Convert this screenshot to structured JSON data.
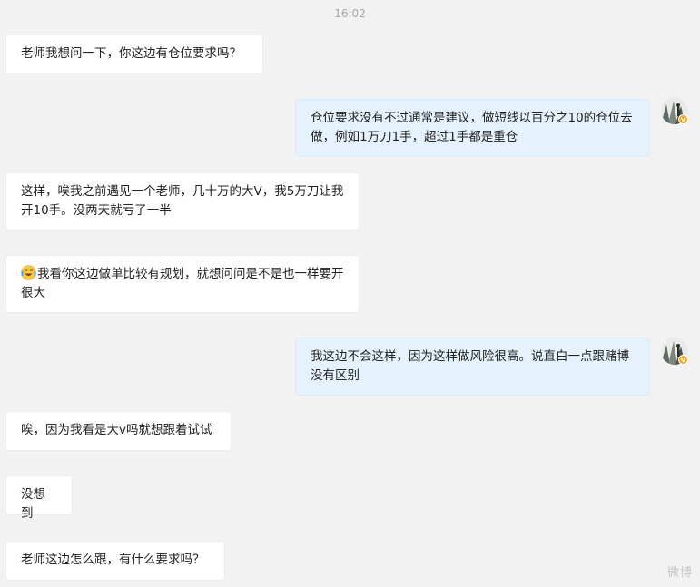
{
  "chat": {
    "timestamp": "16:02",
    "messages": [
      {
        "side": "left",
        "text": "老师我想问一下，你这边有仓位要求吗？"
      },
      {
        "side": "right",
        "text": "仓位要求没有不过通常是建议，做短线以百分之10的仓位去做，例如1万刀1手，超过1手都是重仓"
      },
      {
        "side": "left",
        "text": "这样，唉我之前遇见一个老师，几十万的大V，我5万刀让我开10手。没两天就亏了一半"
      },
      {
        "side": "left",
        "emoji": "crying-laugh-emoji",
        "text": "我看你这边做单比较有规划，就想问问是不是也一样要开很大"
      },
      {
        "side": "right",
        "text": "我这边不会这样，因为这样做风险很高。说直白一点跟赌博没有区别"
      },
      {
        "side": "left",
        "text": "唉，因为我看是大v吗就想跟着试试"
      },
      {
        "side": "left",
        "text": "没想到"
      },
      {
        "side": "left",
        "text": "老师这边怎么跟，有什么要求吗？"
      }
    ]
  },
  "avatar": {
    "badge_icon": "verified-v-badge-icon",
    "badge_color": "#f5a623"
  },
  "watermark": {
    "text": "微博"
  }
}
